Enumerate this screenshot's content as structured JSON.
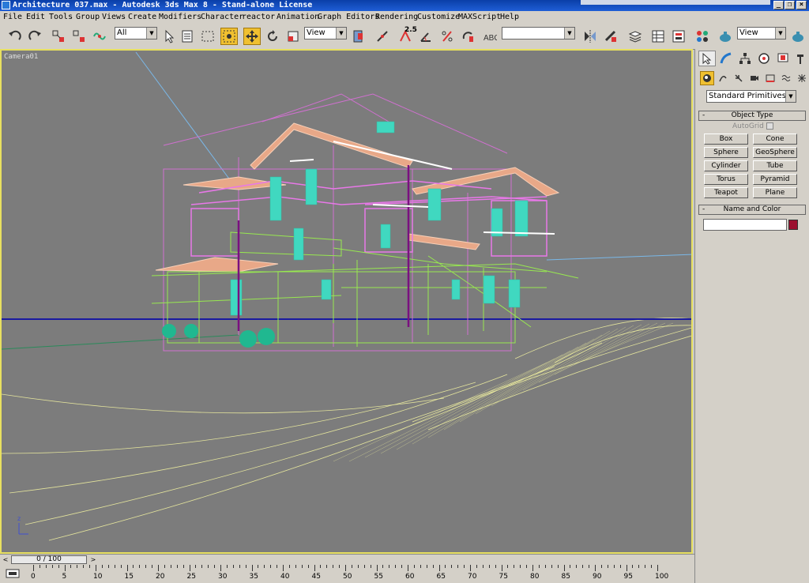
{
  "titlebar": {
    "title": "Architecture 037.max - Autodesk 3ds Max 8  - Stand-alone License",
    "minimize": "_",
    "restore": "❐",
    "close": "×"
  },
  "menu": [
    "File",
    "Edit",
    "Tools",
    "Group",
    "Views",
    "Create",
    "Modifiers",
    "Character",
    "reactor",
    "Animation",
    "Graph Editors",
    "Rendering",
    "Customize",
    "MAXScript",
    "Help"
  ],
  "toolbar": {
    "selection_filter": "All",
    "ref_coord": "View",
    "snap_value": "2.5",
    "named_selection": "",
    "render_view": "View"
  },
  "viewport": {
    "label": "Camera01",
    "axis_label": "z"
  },
  "command_panel": {
    "category_dropdown": "Standard Primitives",
    "object_type": {
      "header": "Object Type",
      "autogrid": "AutoGrid",
      "buttons": [
        "Box",
        "Cone",
        "Sphere",
        "GeoSphere",
        "Cylinder",
        "Tube",
        "Torus",
        "Pyramid",
        "Teapot",
        "Plane"
      ]
    },
    "name_color": {
      "header": "Name and Color",
      "name_value": "",
      "swatch_color": "#9c1030"
    }
  },
  "timeline": {
    "slider_label": "0 / 100",
    "prev": "<",
    "next": ">",
    "ticks": [
      "0",
      "5",
      "10",
      "15",
      "20",
      "25",
      "30",
      "35",
      "40",
      "45",
      "50",
      "55",
      "60",
      "65",
      "70",
      "75",
      "80",
      "85",
      "90",
      "95",
      "100"
    ]
  },
  "colors": {
    "viewport_bg": "#7c7c7c",
    "active_border": "#e8e060",
    "highlight": "#f0c030"
  }
}
